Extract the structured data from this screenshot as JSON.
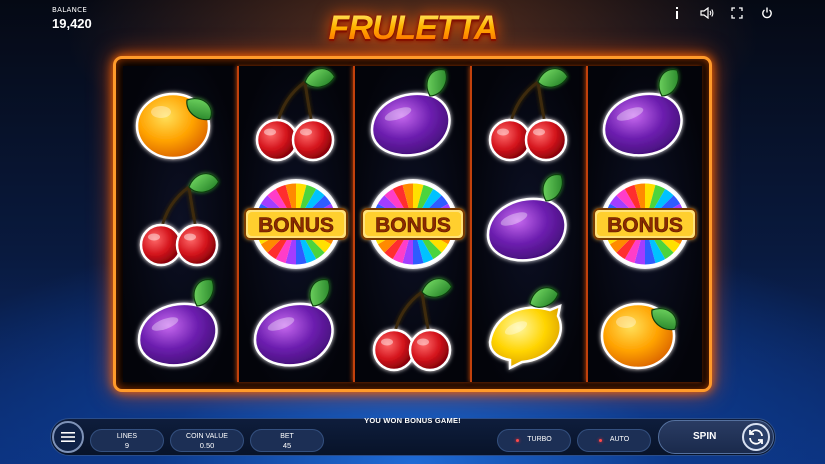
{
  "game_title": "FRULETTA",
  "balance": {
    "label": "BALANCE",
    "value": "19,420"
  },
  "top_icons": [
    "info-icon",
    "sound-icon",
    "fullscreen-icon",
    "power-icon"
  ],
  "reels": [
    [
      "orange",
      "cherry",
      "plum"
    ],
    [
      "cherry",
      "bonus",
      "plum"
    ],
    [
      "plum",
      "bonus",
      "cherry"
    ],
    [
      "cherry",
      "plum",
      "lemon"
    ],
    [
      "plum",
      "bonus",
      "orange"
    ]
  ],
  "bonus_label": "BONUS",
  "message": "YOU WON BONUS GAME!",
  "controls": {
    "menu_icon": "hamburger-icon",
    "lines": {
      "label": "LINES",
      "value": "9"
    },
    "coin_value": {
      "label": "COIN VALUE",
      "value": "0.50"
    },
    "bet": {
      "label": "BET",
      "value": "45"
    },
    "turbo_label": "TURBO",
    "auto_label": "AUTO",
    "spin_label": "SPIN",
    "spin_icon": "refresh-icon"
  },
  "colors": {
    "frame": "#ff9a2a",
    "bar": "#0e1d3c",
    "accent": "#ffb400"
  }
}
